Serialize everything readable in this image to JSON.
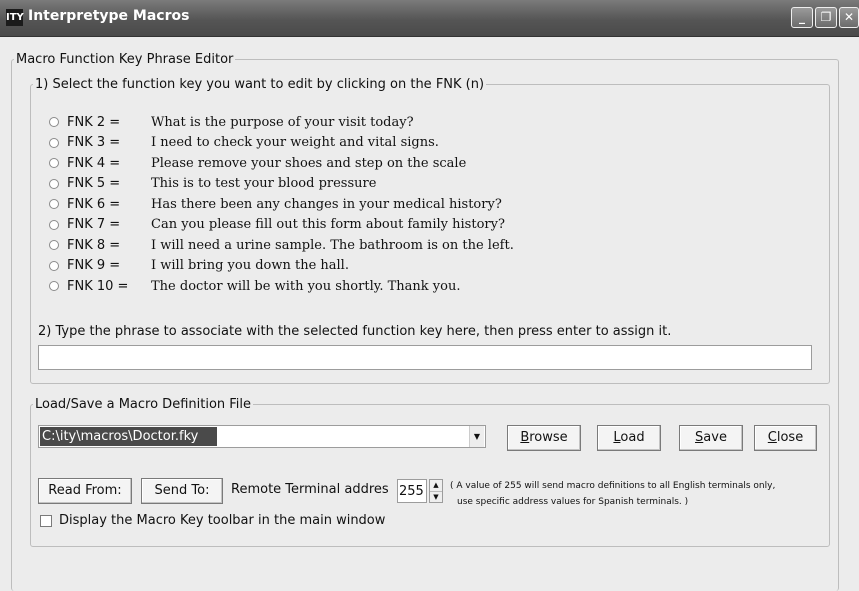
{
  "window": {
    "logo_text": "ITY",
    "title": "Interpretype Macros",
    "minimize_glyph": "_",
    "maximize_glyph": "❐",
    "close_glyph": "✕"
  },
  "editor": {
    "legend": "Macro Function Key Phrase Editor",
    "step1_legend": "1) Select the function key you want to edit by clicking on the FNK (n)",
    "keys": [
      {
        "label": "FNK 2 =",
        "phrase": "What is the purpose of your visit today?"
      },
      {
        "label": "FNK 3 =",
        "phrase": "I need to check your weight and vital signs."
      },
      {
        "label": "FNK 4 =",
        "phrase": "Please remove your shoes and step on the scale"
      },
      {
        "label": "FNK 5 =",
        "phrase": "This is to test your blood pressure"
      },
      {
        "label": "FNK 6 =",
        "phrase": "Has there been any changes in your medical history?"
      },
      {
        "label": "FNK 7 =",
        "phrase": "Can you please fill out this form about family history?"
      },
      {
        "label": "FNK 8 =",
        "phrase": "I will need a urine sample. The bathroom is on the left."
      },
      {
        "label": "FNK 9 =",
        "phrase": "I will bring you down the hall."
      },
      {
        "label": "FNK 10 =",
        "phrase": "The doctor will be with you shortly. Thank you."
      }
    ],
    "step2_label": "2) Type the phrase to associate with the selected function key here, then press enter to assign it.",
    "phrase_input_value": ""
  },
  "file": {
    "legend": "Load/Save a Macro Definition File",
    "path_value": "C:\\ity\\macros\\Doctor.fky",
    "dropdown_arrow": "▼",
    "browse_label": "Browse",
    "load_label": "Load",
    "save_label": "Save",
    "close_label": "Close",
    "read_from_label": "Read From:",
    "send_to_label": "Send To:",
    "remote_terminal_label": "Remote Terminal addres",
    "remote_terminal_value": "255",
    "spin_up": "▲",
    "spin_down": "▼",
    "note_line1": "( A value of 255 will send macro definitions to all English terminals only,",
    "note_line2": "use specific address values for Spanish terminals. )",
    "toolbar_checkbox_label": "Display the Macro Key toolbar in the main window",
    "toolbar_checkbox_checked": false
  }
}
